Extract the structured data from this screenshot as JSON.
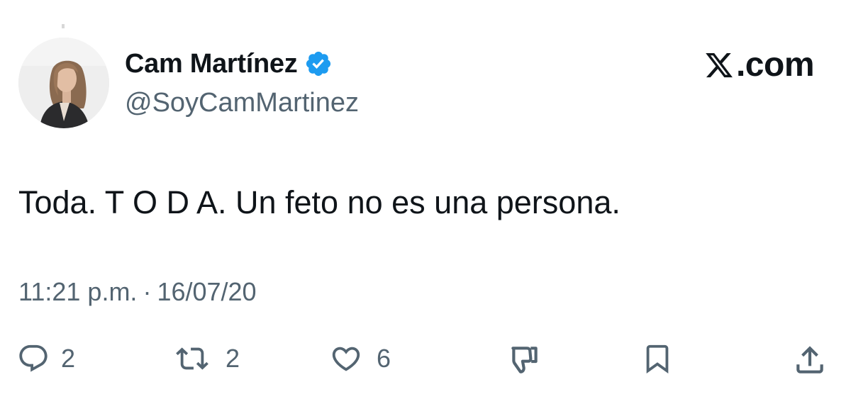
{
  "author": {
    "display_name": "Cam Martínez",
    "handle": "@SoyCamMartinez",
    "verified": true,
    "verified_color": "#1d9bf0"
  },
  "brand": {
    "label": ".com",
    "logo_icon": "x-logo-icon"
  },
  "tweet": {
    "text": "Toda. T O D A. Un feto no es una persona.",
    "time": "11:21 p.m.",
    "separator": "·",
    "date": "16/07/20"
  },
  "actions": {
    "reply": {
      "icon": "reply-icon",
      "count": "2"
    },
    "retweet": {
      "icon": "retweet-icon",
      "count": "2"
    },
    "like": {
      "icon": "heart-icon",
      "count": "6"
    },
    "downvote": {
      "icon": "thumbs-down-icon"
    },
    "bookmark": {
      "icon": "bookmark-icon"
    },
    "share": {
      "icon": "share-icon"
    }
  },
  "colors": {
    "text": "#0f1419",
    "secondary_text": "#536471",
    "background": "#ffffff"
  }
}
